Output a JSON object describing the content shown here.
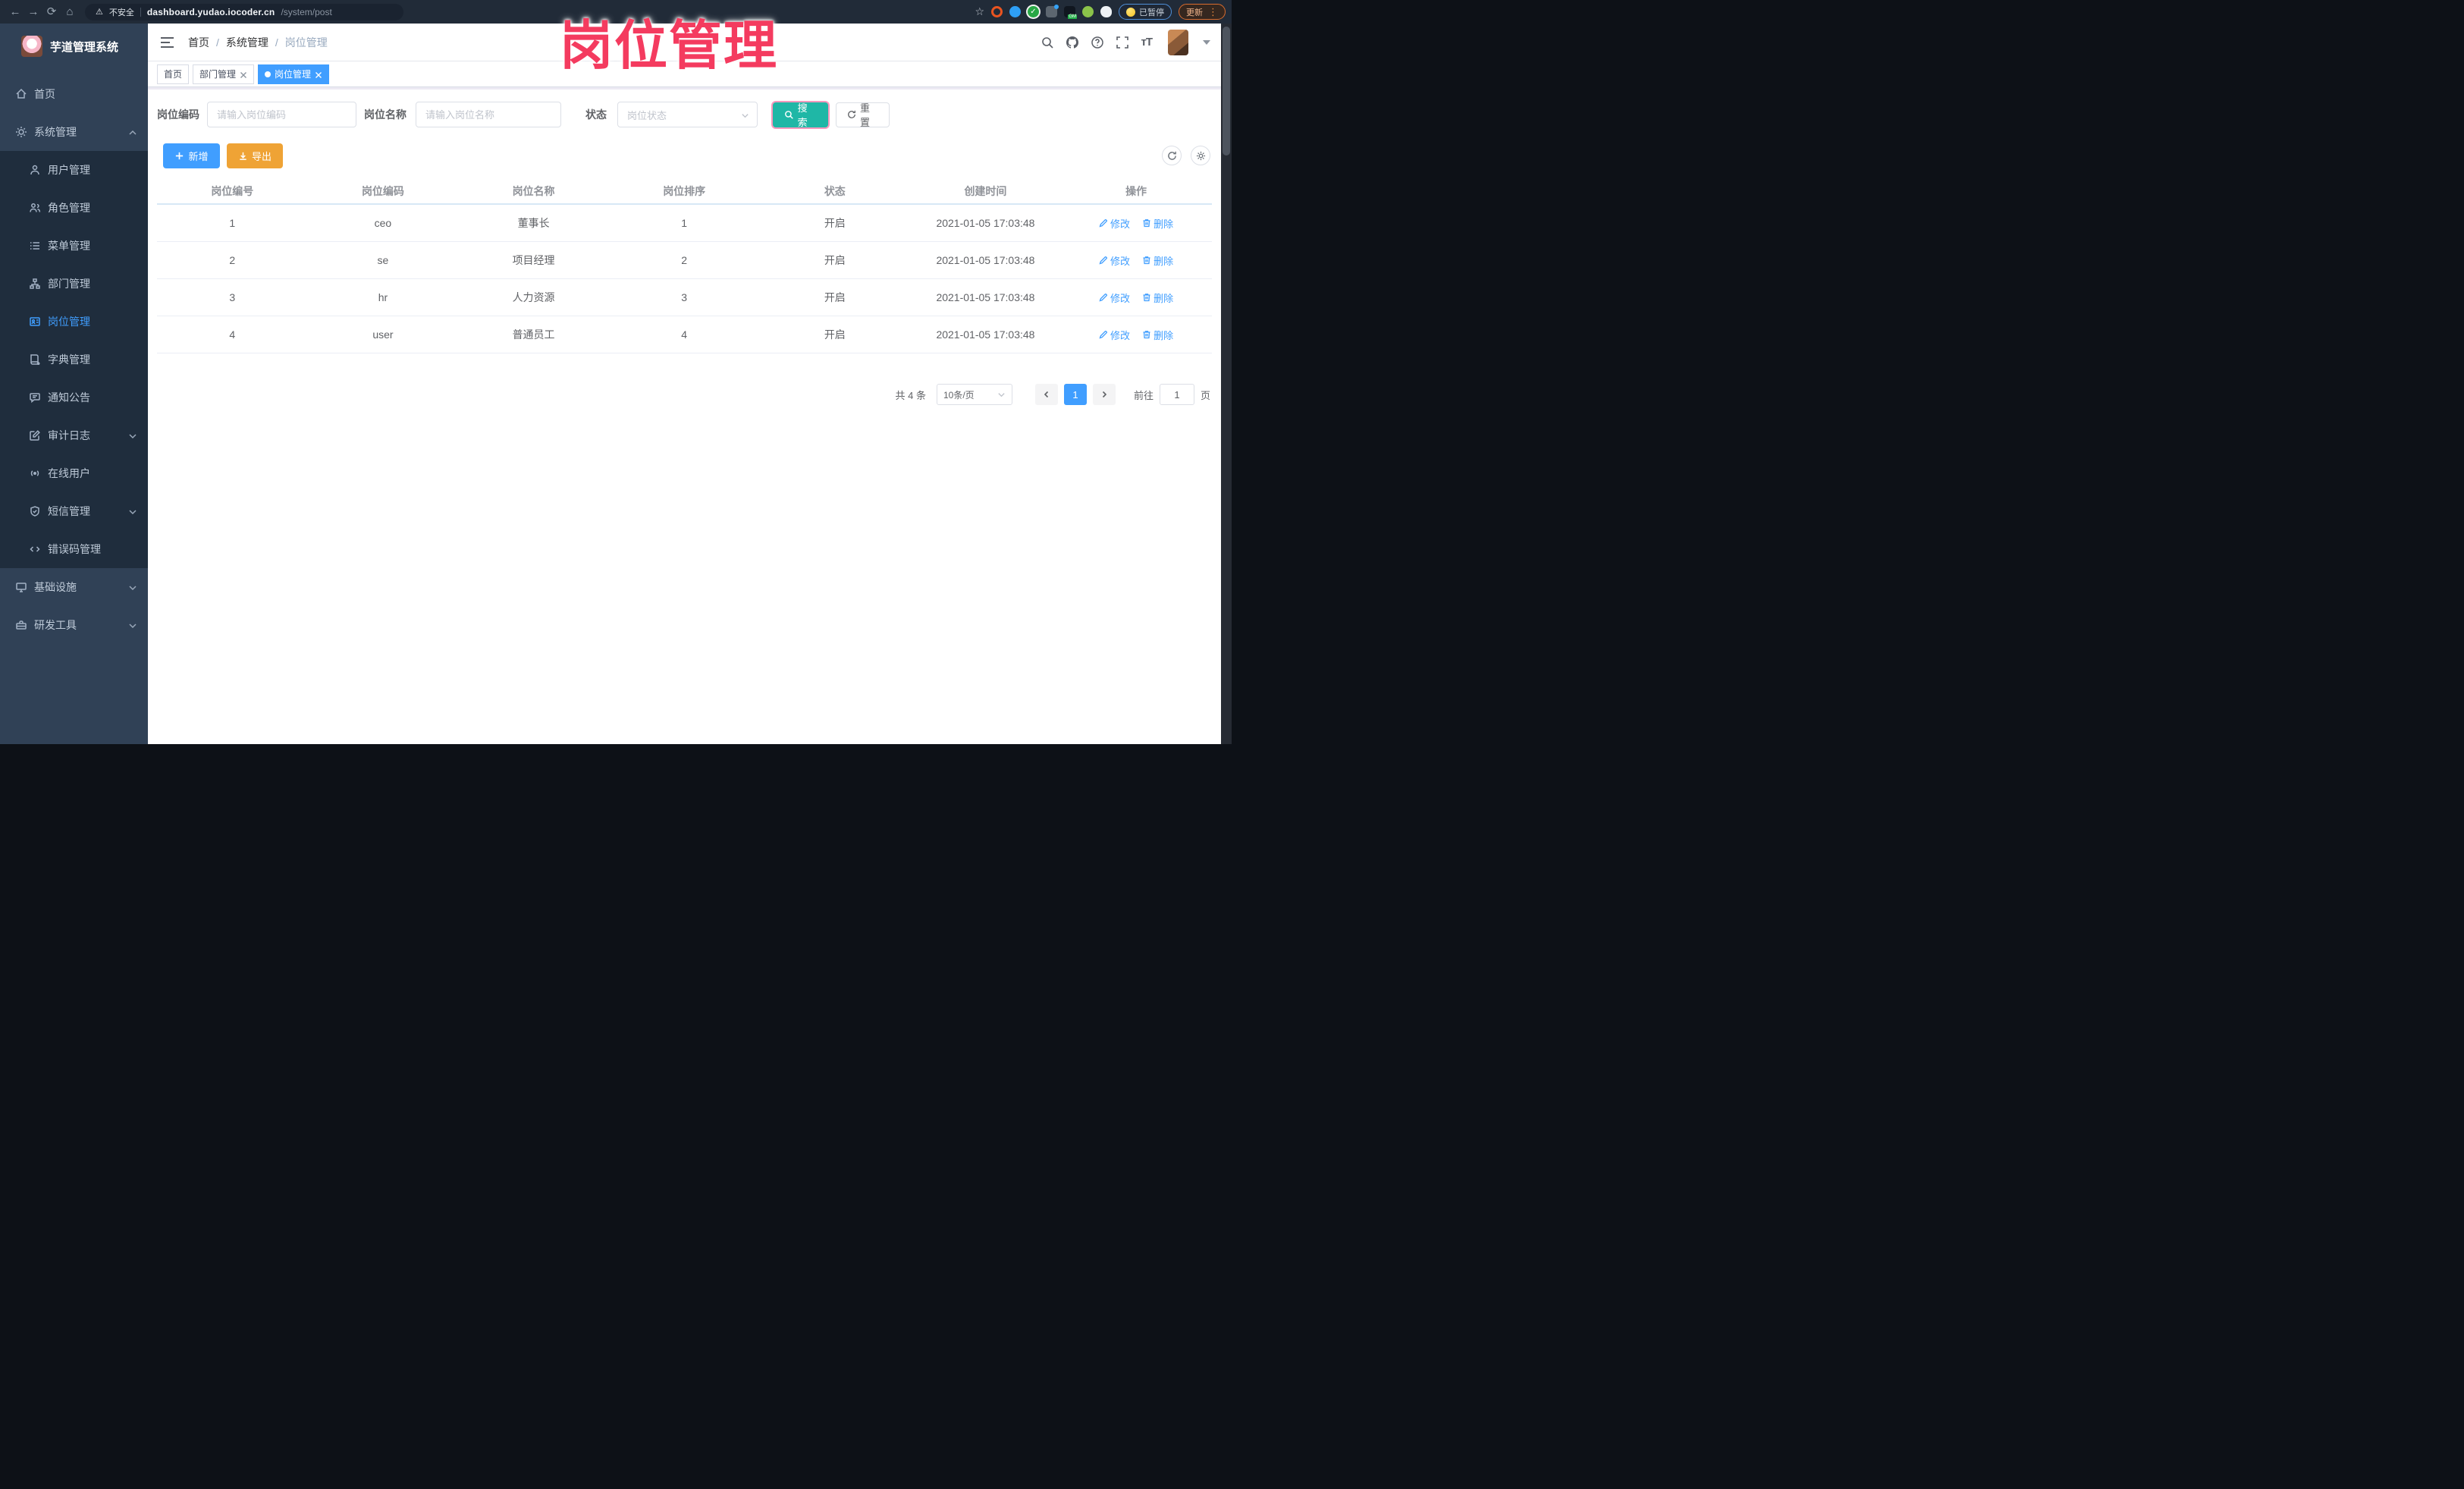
{
  "browser": {
    "security_label": "不安全",
    "url_host": "dashboard.yudao.iocoder.cn",
    "url_path": "/system/post",
    "paused_label": "已暂停",
    "update_label": "更新"
  },
  "watermark": "岗位管理",
  "sidebar": {
    "app_title": "芋道管理系统",
    "items": [
      {
        "label": "首页"
      },
      {
        "label": "系统管理"
      },
      {
        "label": "用户管理"
      },
      {
        "label": "角色管理"
      },
      {
        "label": "菜单管理"
      },
      {
        "label": "部门管理"
      },
      {
        "label": "岗位管理"
      },
      {
        "label": "字典管理"
      },
      {
        "label": "通知公告"
      },
      {
        "label": "审计日志"
      },
      {
        "label": "在线用户"
      },
      {
        "label": "短信管理"
      },
      {
        "label": "错误码管理"
      },
      {
        "label": "基础设施"
      },
      {
        "label": "研发工具"
      }
    ]
  },
  "breadcrumb": {
    "items": [
      "首页",
      "系统管理",
      "岗位管理"
    ]
  },
  "tabs": [
    {
      "label": "首页"
    },
    {
      "label": "部门管理"
    },
    {
      "label": "岗位管理"
    }
  ],
  "filters": {
    "post_code_label": "岗位编码",
    "post_code_placeholder": "请输入岗位编码",
    "post_name_label": "岗位名称",
    "post_name_placeholder": "请输入岗位名称",
    "status_label": "状态",
    "status_placeholder": "岗位状态",
    "search_label": "搜索",
    "reset_label": "重置"
  },
  "toolbar": {
    "add_label": "新增",
    "export_label": "导出"
  },
  "table": {
    "columns": [
      "岗位编号",
      "岗位编码",
      "岗位名称",
      "岗位排序",
      "状态",
      "创建时间",
      "操作"
    ],
    "edit_label": "修改",
    "delete_label": "删除",
    "rows": [
      {
        "id": "1",
        "code": "ceo",
        "name": "董事长",
        "sort": "1",
        "status": "开启",
        "created": "2021-01-05 17:03:48"
      },
      {
        "id": "2",
        "code": "se",
        "name": "项目经理",
        "sort": "2",
        "status": "开启",
        "created": "2021-01-05 17:03:48"
      },
      {
        "id": "3",
        "code": "hr",
        "name": "人力资源",
        "sort": "3",
        "status": "开启",
        "created": "2021-01-05 17:03:48"
      },
      {
        "id": "4",
        "code": "user",
        "name": "普通员工",
        "sort": "4",
        "status": "开启",
        "created": "2021-01-05 17:03:48"
      }
    ]
  },
  "pagination": {
    "total_label": "共 4 条",
    "page_size_value": "10条/页",
    "current_page": "1",
    "goto_label": "前往",
    "goto_value": "1",
    "page_unit": "页"
  },
  "colors": {
    "primary": "#409eff",
    "search_button": "#1fb7a6",
    "export_button": "#efa335",
    "watermark": "#f43b5f",
    "sidebar_bg": "#304156",
    "submenu_bg": "#1f2d3d"
  }
}
